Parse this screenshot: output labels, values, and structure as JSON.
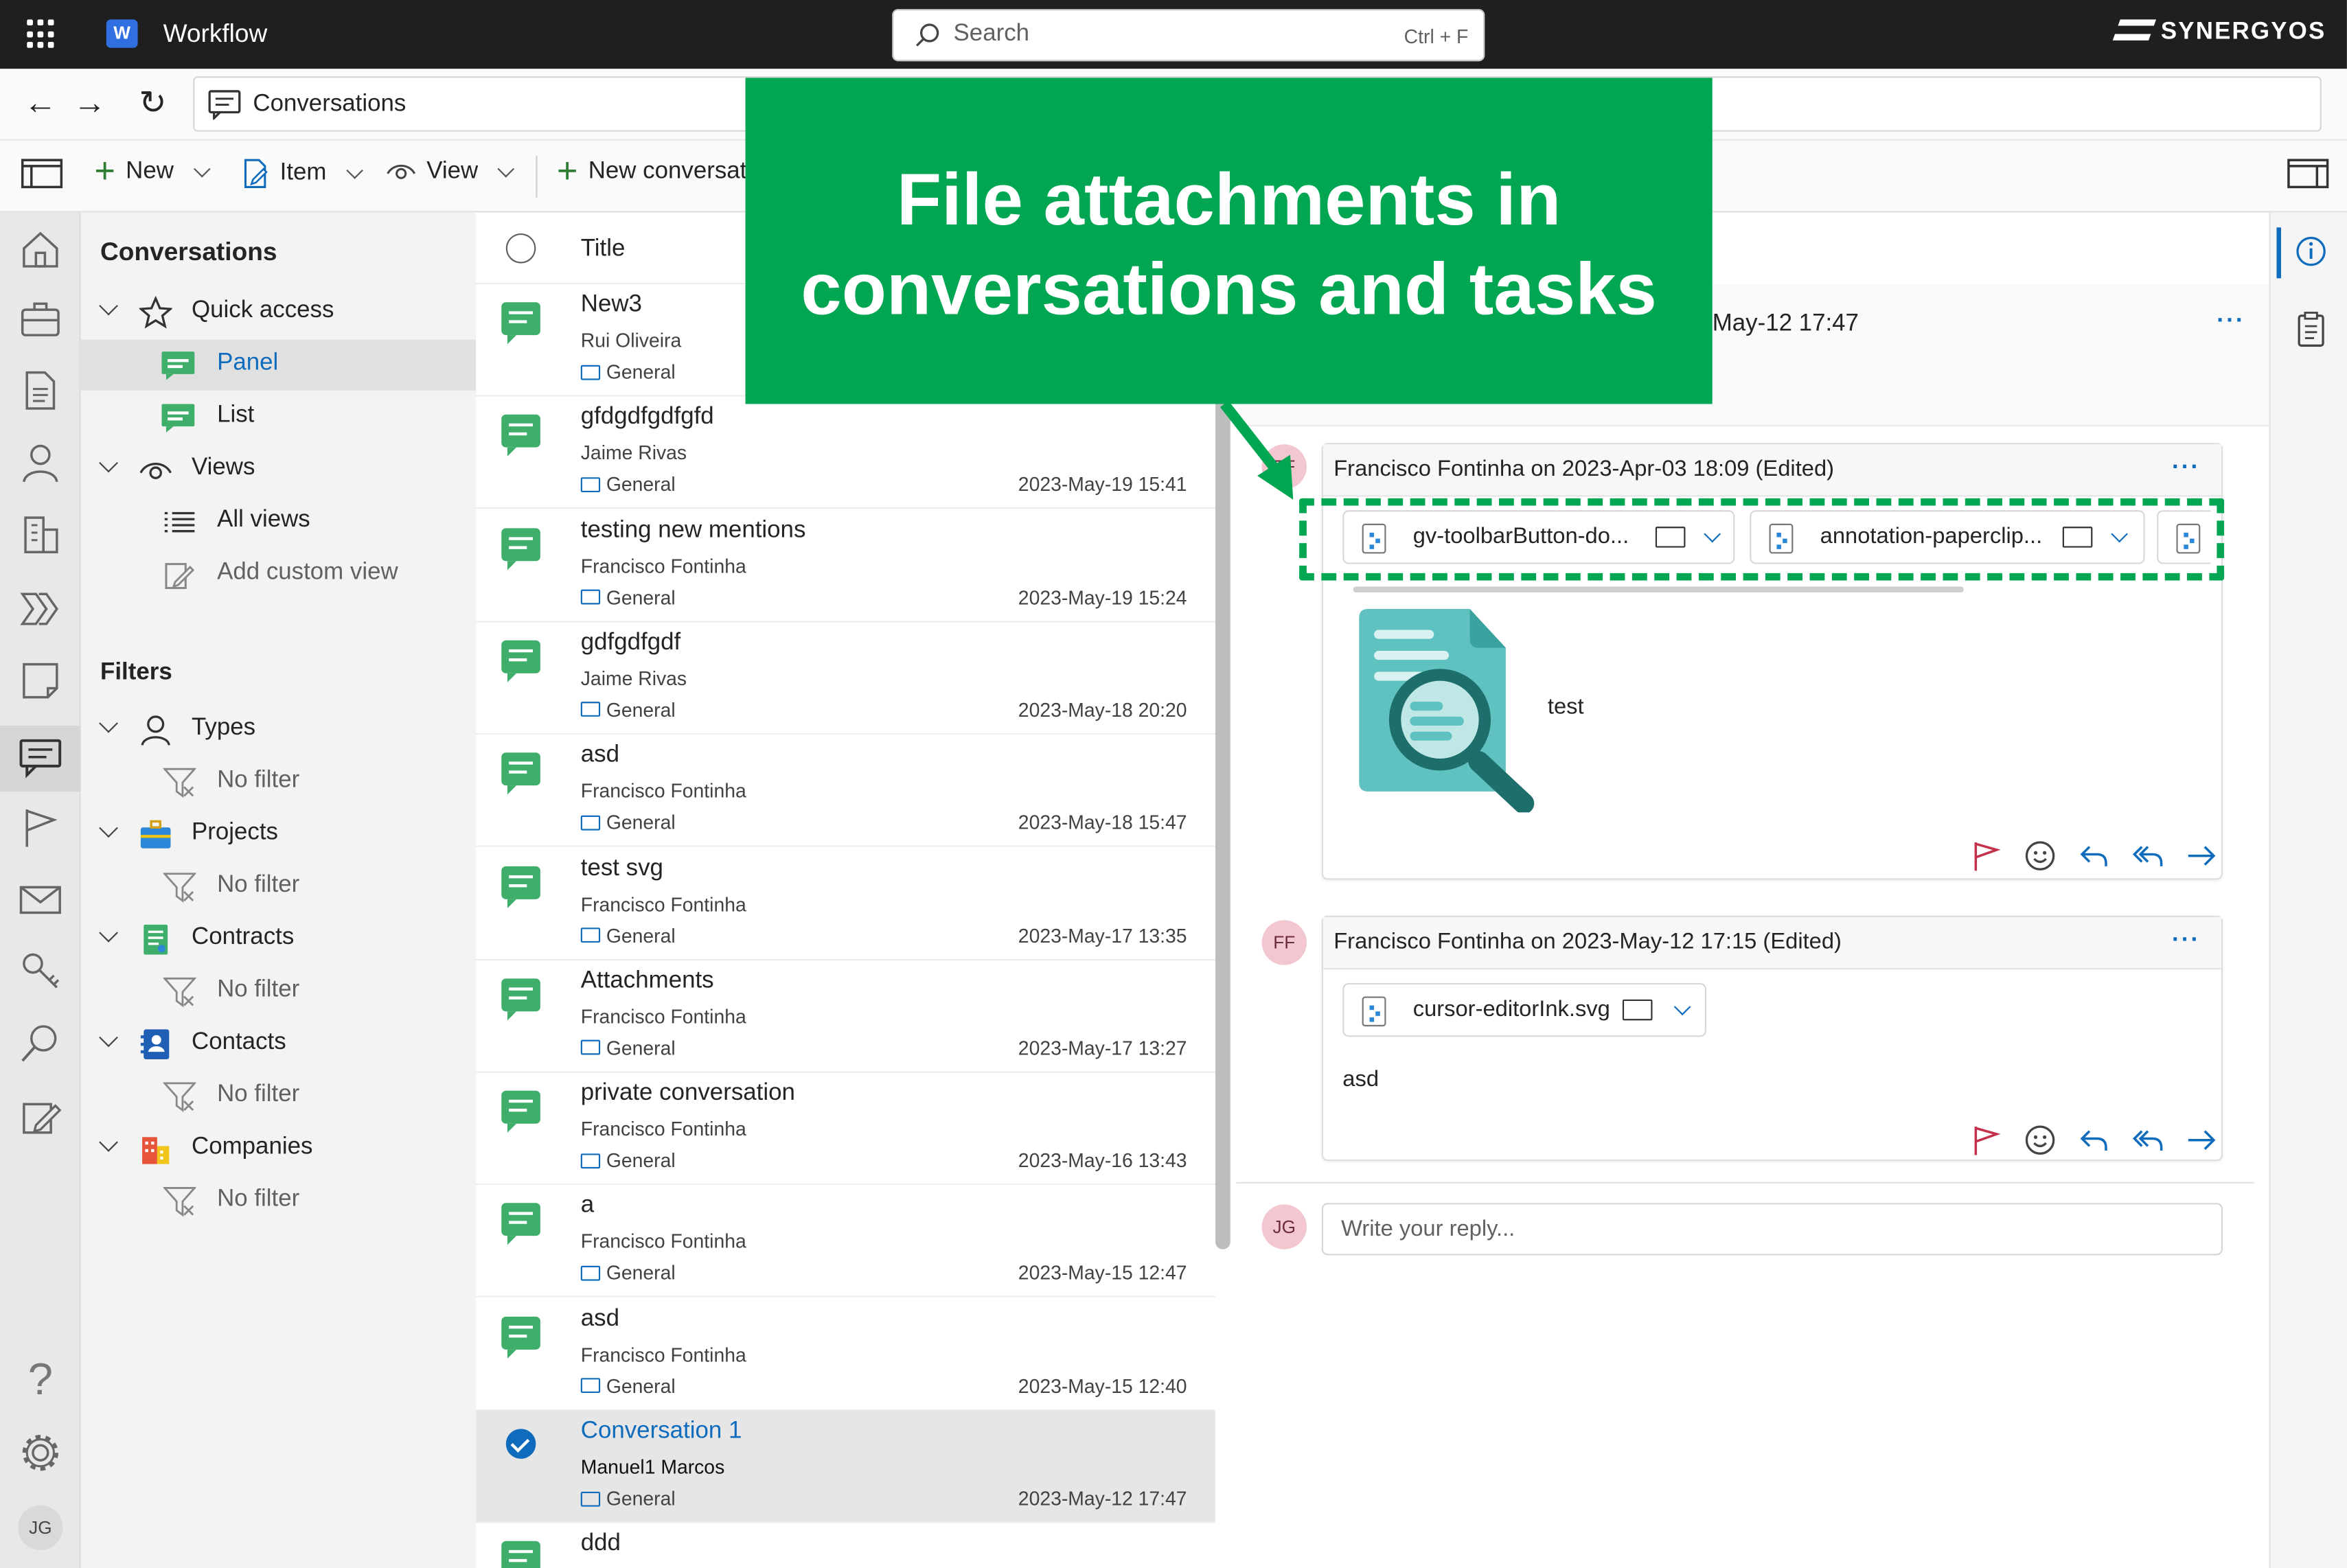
{
  "app": {
    "title": "Workflow",
    "brand": "SYNERGYOS"
  },
  "search": {
    "placeholder": "Search",
    "shortcut": "Ctrl + F"
  },
  "address": {
    "title": "Conversations"
  },
  "toolbar": {
    "new_label": "New",
    "item_label": "Item",
    "view_label": "View",
    "new_conversation_label": "New conversat"
  },
  "nav": {
    "heading": "Conversations",
    "quick_access": "Quick access",
    "panel": "Panel",
    "list": "List",
    "views": "Views",
    "all_views": "All views",
    "add_custom_view": "Add custom view",
    "filters_heading": "Filters",
    "filters": [
      {
        "label": "Types",
        "value": "No filter"
      },
      {
        "label": "Projects",
        "value": "No filter"
      },
      {
        "label": "Contracts",
        "value": "No filter"
      },
      {
        "label": "Contacts",
        "value": "No filter"
      },
      {
        "label": "Companies",
        "value": "No filter"
      }
    ]
  },
  "list": {
    "column_title": "Title",
    "rows": [
      {
        "title": "New3",
        "author": "Rui Oliveira",
        "category": "General",
        "date": ""
      },
      {
        "title": "gfdgdfgdfgfd",
        "author": "Jaime Rivas",
        "category": "General",
        "date": "2023-May-19 15:41"
      },
      {
        "title": "testing new mentions",
        "author": "Francisco Fontinha",
        "category": "General",
        "date": "2023-May-19 15:24"
      },
      {
        "title": "gdfgdfgdf",
        "author": "Jaime Rivas",
        "category": "General",
        "date": "2023-May-18 20:20"
      },
      {
        "title": "asd",
        "author": "Francisco Fontinha",
        "category": "General",
        "date": "2023-May-18 15:47"
      },
      {
        "title": "test svg",
        "author": "Francisco Fontinha",
        "category": "General",
        "date": "2023-May-17 13:35"
      },
      {
        "title": "Attachments",
        "author": "Francisco Fontinha",
        "category": "General",
        "date": "2023-May-17 13:27"
      },
      {
        "title": "private conversation",
        "author": "Francisco Fontinha",
        "category": "General",
        "date": "2023-May-16 13:43"
      },
      {
        "title": "a",
        "author": "Francisco Fontinha",
        "category": "General",
        "date": "2023-May-15 12:47"
      },
      {
        "title": "asd",
        "author": "Francisco Fontinha",
        "category": "General",
        "date": "2023-May-15 12:40"
      },
      {
        "title": "Conversation 1",
        "author": "Manuel1 Marcos",
        "category": "General",
        "date": "2023-May-12 17:47",
        "selected": true
      },
      {
        "title": "ddd",
        "author": "",
        "category": "",
        "date": ""
      }
    ]
  },
  "detail": {
    "header_date": "May-12 17:47",
    "messages": [
      {
        "avatar": "FF",
        "author_line": "Francisco Fontinha on 2023-Apr-03 18:09 (Edited)",
        "attachments": [
          "gv-toolbarButton-do...",
          "annotation-paperclip..."
        ],
        "body": "test"
      },
      {
        "avatar": "FF",
        "author_line": "Francisco Fontinha on 2023-May-12 17:15 (Edited)",
        "attachments": [
          "cursor-editorInk.svg"
        ],
        "body": "asd"
      }
    ],
    "reply_avatar": "JG",
    "reply_placeholder": "Write your reply..."
  },
  "user": {
    "initials": "JG"
  },
  "callout": {
    "line1": "File attachments in",
    "line2": "conversations and tasks",
    "color": "#00a651"
  }
}
